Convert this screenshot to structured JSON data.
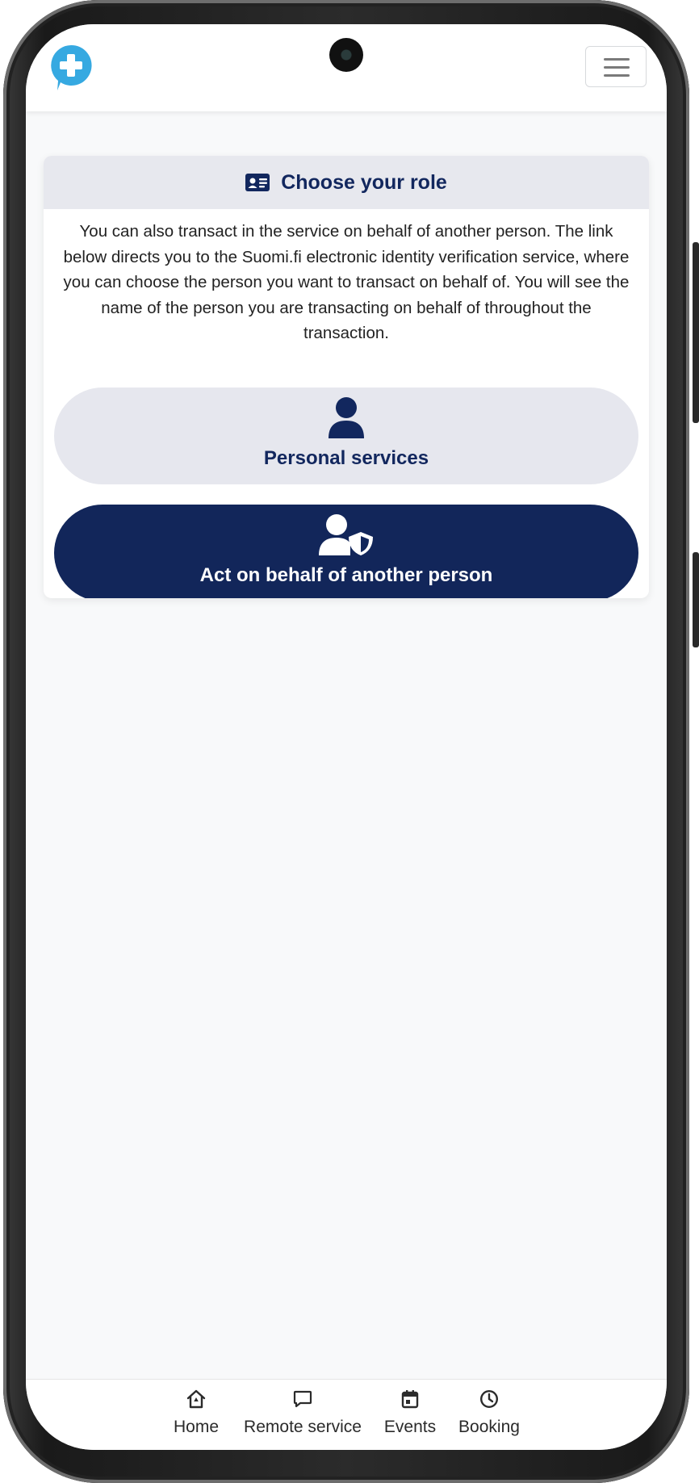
{
  "header": {
    "logo_icon": "medical-cross-bubble-icon",
    "menu_icon": "hamburger-menu-icon"
  },
  "role_card": {
    "title": "Choose your role",
    "title_icon": "id-card-icon",
    "description": "You can also transact in the service on behalf of another person. The link below directs you to the Suomi.fi electronic identity verification service, where you can choose the person you want to transact on behalf of. You will see the name of the person you are transacting on behalf of throughout the transaction.",
    "personal_button": {
      "label": "Personal services",
      "icon": "user-icon"
    },
    "behalf_button": {
      "label": "Act on behalf of another person",
      "icon": "user-shield-icon"
    }
  },
  "bottom_nav": {
    "items": [
      {
        "label": "Home",
        "icon": "home-icon"
      },
      {
        "label": "Remote service",
        "icon": "chat-bubble-icon"
      },
      {
        "label": "Events",
        "icon": "calendar-icon"
      },
      {
        "label": "Booking",
        "icon": "clock-icon"
      }
    ]
  },
  "colors": {
    "brand_navy": "#12265a",
    "brand_light": "#e6e7ee",
    "logo_blue": "#36a9e1"
  }
}
